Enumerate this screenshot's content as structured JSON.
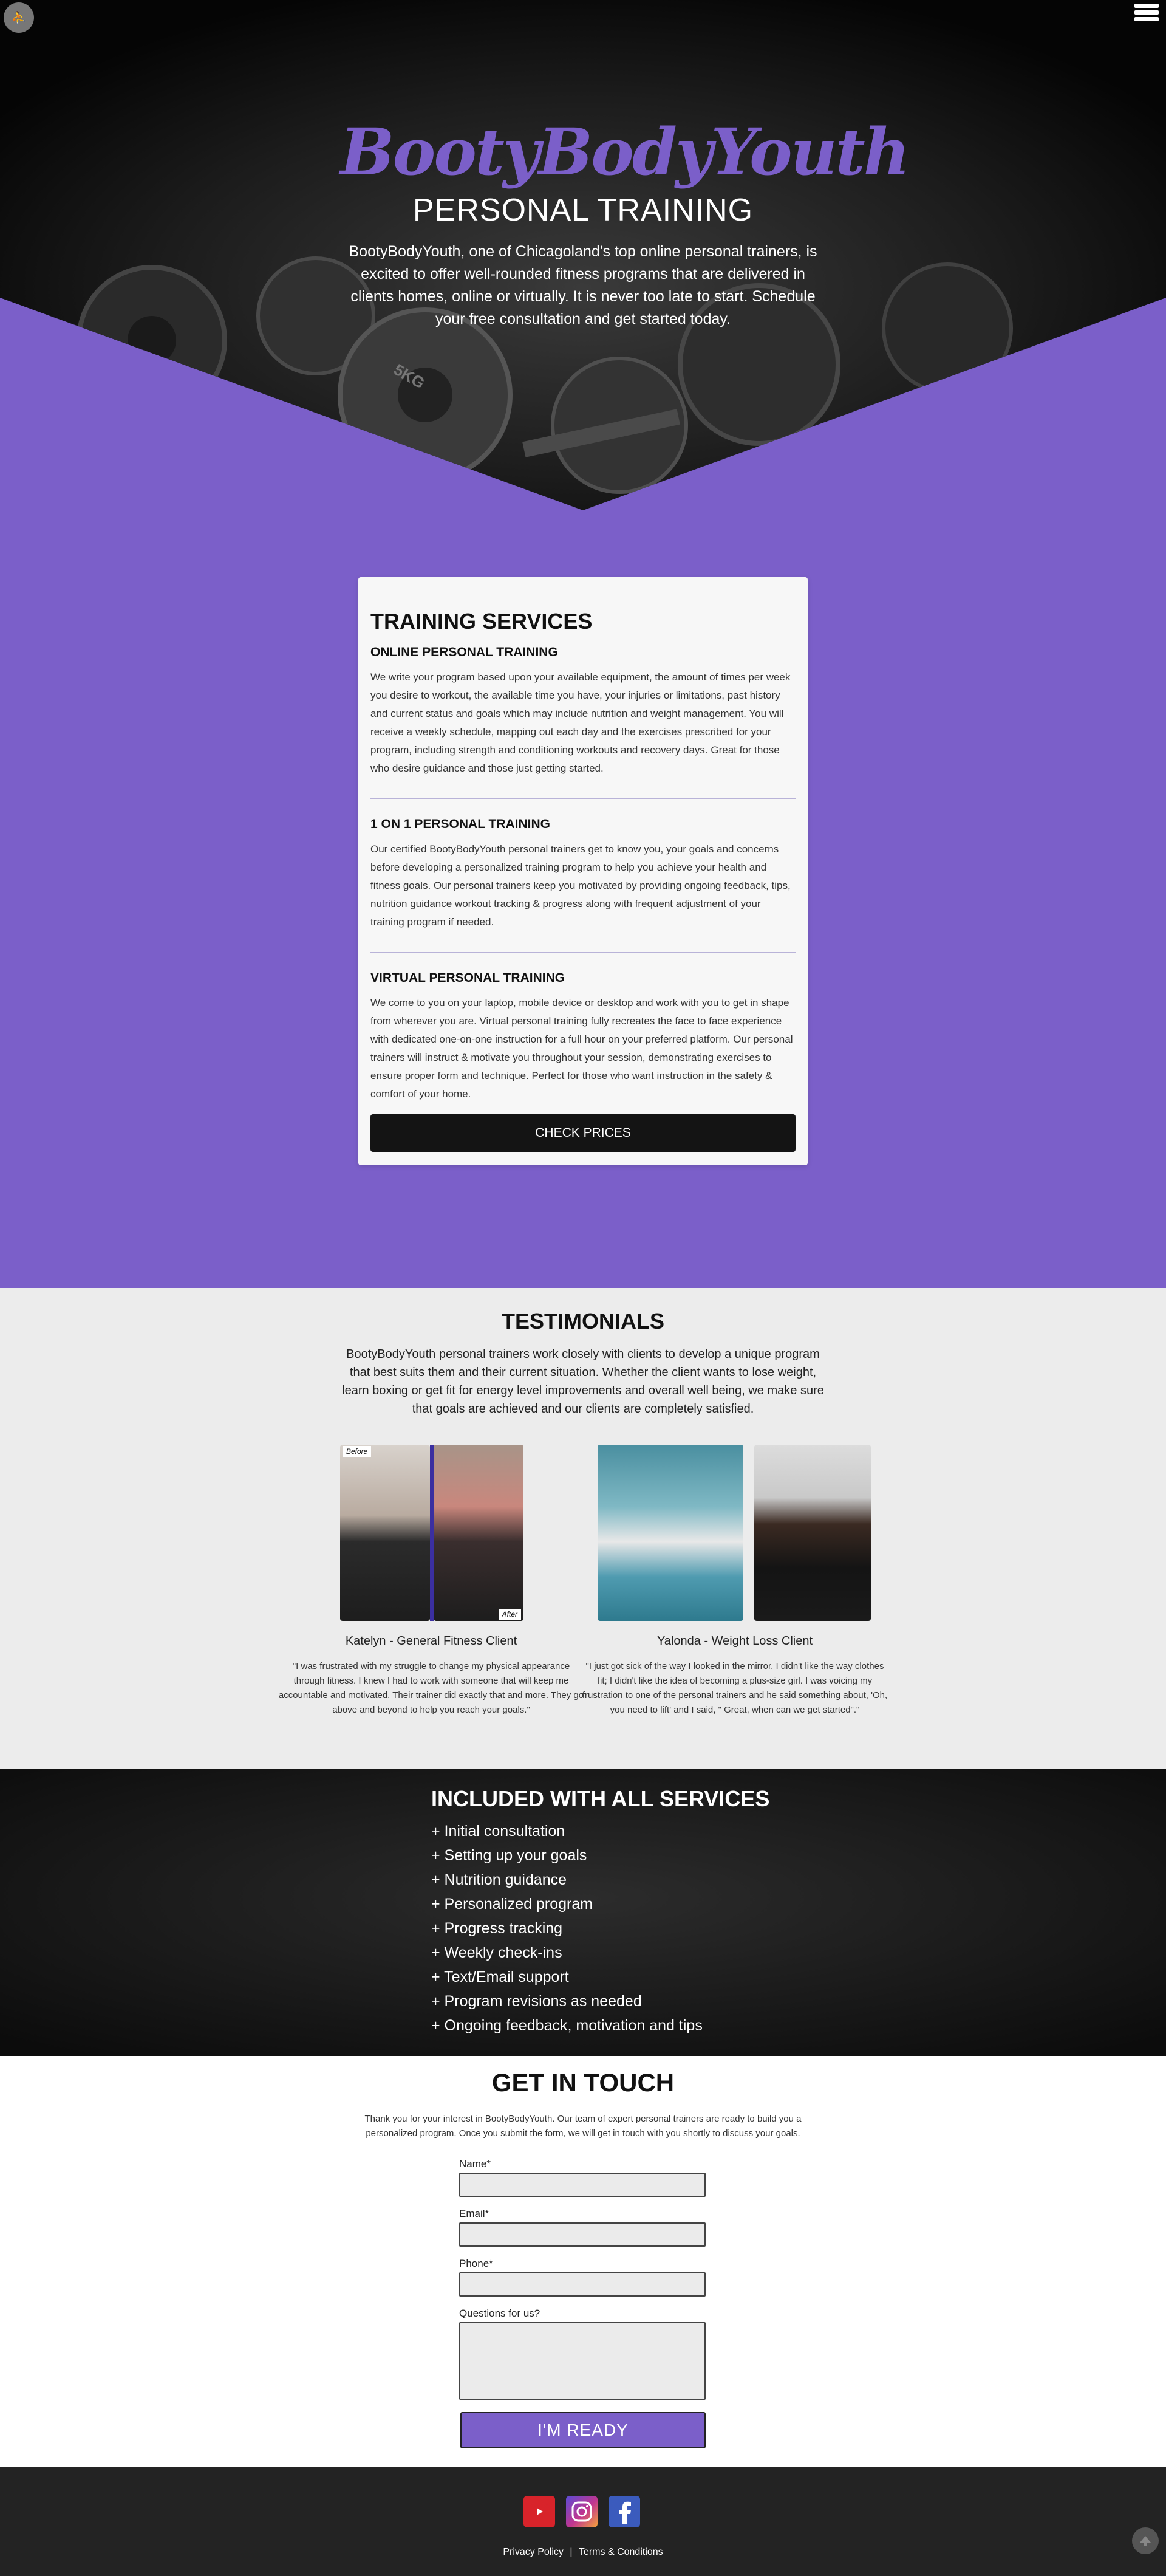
{
  "header": {
    "logo_glyph": "⛹",
    "menu_icon": "hamburger-icon"
  },
  "hero": {
    "brand": "BootyBodyYouth",
    "subtitle": "PERSONAL TRAINING",
    "text": "BootyBodyYouth, one of Chicagoland's top online personal trainers, is excited to offer well-rounded fitness programs that are delivered in clients homes, online or virtually. It is never too late to start. Schedule your free consultation and get started today.",
    "weight_label": "5KG"
  },
  "services": {
    "title": "TRAINING SERVICES",
    "items": [
      {
        "title": "ONLINE PERSONAL TRAINING",
        "text": "We write your program based upon your available equipment, the amount of times per week you desire to workout, the available time you have, your injuries or limitations, past history and current status and goals which may include nutrition and weight management. You will receive a weekly schedule, mapping out each day and the exercises prescribed for your program, including strength and conditioning workouts and recovery days. Great for those who desire guidance and those just getting started."
      },
      {
        "title": "1 ON 1 PERSONAL TRAINING",
        "text": "Our certified BootyBodyYouth personal trainers get to know you, your goals and concerns before developing a personalized training program to help you achieve your health and fitness goals. Our personal trainers keep you motivated by providing ongoing feedback, tips, nutrition guidance workout tracking & progress along with frequent adjustment of your training program if needed."
      },
      {
        "title": "VIRTUAL PERSONAL TRAINING",
        "text": "We come to you on your laptop, mobile device or desktop and work with you to get in shape from wherever you are. Virtual personal training fully recreates the face to face experience with dedicated one-on-one instruction for a full hour on your preferred platform. Our personal trainers will instruct & motivate you throughout your session, demonstrating exercises to ensure proper form and technique. Perfect for those who want instruction in the safety & comfort of your home."
      }
    ],
    "button_label": "CHECK PRICES"
  },
  "testimonials": {
    "title": "TESTIMONIALS",
    "intro": "BootyBodyYouth personal trainers work closely with clients to develop a unique program that best suits them and their current situation. Whether the client wants to lose weight, learn boxing or get fit for energy level improvements and overall well being, we make sure that goals are achieved and our clients are completely satisfied.",
    "before_label": "Before",
    "after_label": "After",
    "items": [
      {
        "name": "Katelyn - General Fitness Client",
        "quote": "\"I was frustrated with my struggle to change my physical appearance through fitness. I knew I had to work with someone that will keep me accountable and motivated. Their trainer did exactly that and more. They go above and beyond to help you reach your goals.\""
      },
      {
        "name": "Yalonda - Weight Loss Client",
        "quote": "\"I just got sick of the way I looked in the mirror. I didn't like the way clothes fit; I didn't like the idea of becoming a plus-size girl. I was voicing my frustration to one of the personal trainers and he said something about, 'Oh, you need to lift' and I said, \" Great, when can we get started\".\""
      }
    ]
  },
  "included": {
    "title": "INCLUDED WITH ALL SERVICES",
    "items": [
      "+ Initial consultation",
      "+ Setting up your goals",
      "+ Nutrition guidance",
      "+ Personalized program",
      "+ Progress tracking",
      "+ Weekly check-ins",
      "+ Text/Email support",
      "+ Program revisions as needed",
      "+ Ongoing feedback, motivation and tips"
    ]
  },
  "contact": {
    "title": "GET IN TOUCH",
    "intro": "Thank you for your interest in BootyBodyYouth. Our team of expert personal trainers are ready to build you a personalized program. Once you submit the form, we will get in touch with you shortly to discuss your goals.",
    "name_label": "Name*",
    "email_label": "Email*",
    "phone_label": "Phone*",
    "questions_label": "Questions for us?",
    "name_value": "",
    "email_value": "",
    "phone_value": "",
    "questions_value": "",
    "submit_label": "I'M READY"
  },
  "footer": {
    "social": [
      "youtube-icon",
      "instagram-icon",
      "facebook-icon"
    ],
    "privacy_label": "Privacy Policy",
    "separator": "|",
    "terms_label": "Terms & Conditions",
    "to_top_icon": "arrow-up-icon"
  },
  "colors": {
    "accent": "#7b5fc9",
    "dark": "#141414",
    "light_gray": "#ececec",
    "footer": "#232323"
  }
}
